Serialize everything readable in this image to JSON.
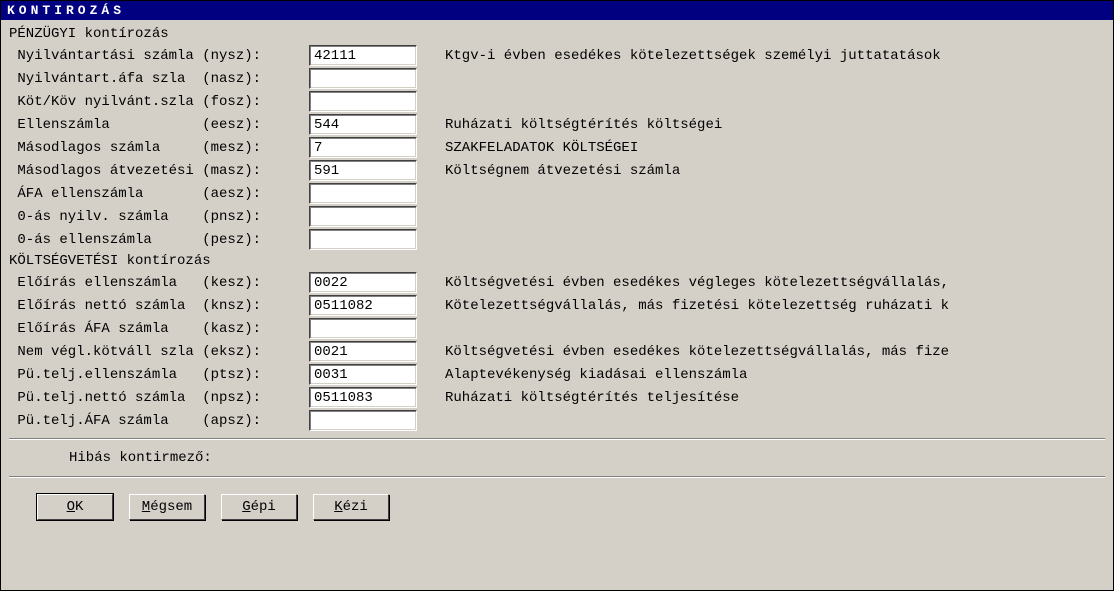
{
  "title": "KONTIROZÁS",
  "section1": "PÉNZÜGYI kontírozás",
  "section2": "KÖLTSÉGVETÉSI kontírozás",
  "rows": {
    "nysz": {
      "label": " Nyilvántartási számla (nysz): ",
      "value": "42111",
      "desc": "Ktgv-i évben esedékes kötelezettségek személyi juttatatások"
    },
    "nasz": {
      "label": " Nyilvántart.áfa szla  (nasz): ",
      "value": "",
      "desc": ""
    },
    "fosz": {
      "label": " Köt/Köv nyilvánt.szla (fosz): ",
      "value": "",
      "desc": ""
    },
    "eesz": {
      "label": " Ellenszámla           (eesz): ",
      "value": "544",
      "desc": "Ruházati költségtérítés költségei"
    },
    "mesz": {
      "label": " Másodlagos számla     (mesz): ",
      "value": "7",
      "desc": "SZAKFELADATOK KÖLTSÉGEI"
    },
    "masz": {
      "label": " Másodlagos átvezetési (masz): ",
      "value": "591",
      "desc": "Költségnem átvezetési számla"
    },
    "aesz": {
      "label": " ÁFA ellenszámla       (aesz): ",
      "value": "",
      "desc": ""
    },
    "pnsz": {
      "label": " 0-ás nyilv. számla    (pnsz): ",
      "value": "",
      "desc": ""
    },
    "pesz": {
      "label": " 0-ás ellenszámla      (pesz): ",
      "value": "",
      "desc": ""
    },
    "kesz": {
      "label": " Előírás ellenszámla   (kesz): ",
      "value": "0022",
      "desc": "Költségvetési évben esedékes végleges kötelezettségvállalás,"
    },
    "knsz": {
      "label": " Előírás nettó számla  (knsz): ",
      "value": "0511082",
      "desc": "Kötelezettségvállalás, más fizetési kötelezettség ruházati k"
    },
    "kasz": {
      "label": " Előírás ÁFA számla    (kasz): ",
      "value": "",
      "desc": ""
    },
    "eksz": {
      "label": " Nem végl.kötváll szla (eksz): ",
      "value": "0021",
      "desc": "Költségvetési évben esedékes kötelezettségvállalás, más fize"
    },
    "ptsz": {
      "label": " Pü.telj.ellenszámla   (ptsz): ",
      "value": "0031",
      "desc": "Alaptevékenység kiadásai ellenszámla"
    },
    "npsz": {
      "label": " Pü.telj.nettó számla  (npsz): ",
      "value": "0511083",
      "desc": "Ruházati költségtérítés teljesítése"
    },
    "apsz": {
      "label": " Pü.telj.ÁFA számla    (apsz): ",
      "value": "",
      "desc": ""
    }
  },
  "status_label": "Hibás kontirmező:",
  "buttons": {
    "ok": {
      "u": "O",
      "rest": "K"
    },
    "cancel": {
      "u": "M",
      "rest": "égsem"
    },
    "gepi": {
      "u": "G",
      "rest": "épi"
    },
    "kezi": {
      "u": "K",
      "rest": "ézi"
    }
  }
}
